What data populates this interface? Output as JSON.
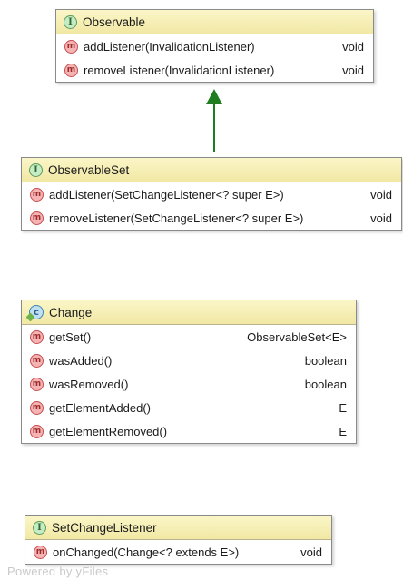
{
  "observable": {
    "title": "Observable",
    "methods": [
      {
        "name": "addListener(InvalidationListener)",
        "ret": "void"
      },
      {
        "name": "removeListener(InvalidationListener)",
        "ret": "void"
      }
    ]
  },
  "observable_set": {
    "title": "ObservableSet",
    "methods": [
      {
        "name": "addListener(SetChangeListener<? super E>)",
        "ret": "void"
      },
      {
        "name": "removeListener(SetChangeListener<? super E>)",
        "ret": "void"
      }
    ]
  },
  "change": {
    "title": "Change",
    "methods": [
      {
        "name": "getSet()",
        "ret": "ObservableSet<E>"
      },
      {
        "name": "wasAdded()",
        "ret": "boolean"
      },
      {
        "name": "wasRemoved()",
        "ret": "boolean"
      },
      {
        "name": "getElementAdded()",
        "ret": "E"
      },
      {
        "name": "getElementRemoved()",
        "ret": "E"
      }
    ]
  },
  "set_change_listener": {
    "title": "SetChangeListener",
    "methods": [
      {
        "name": "onChanged(Change<? extends E>)",
        "ret": "void"
      }
    ]
  },
  "icons": {
    "interface": "I",
    "class": "c",
    "method": "m"
  },
  "colors": {
    "header": "#f4ecb2",
    "inheritance_arrow": "#1f7d1f"
  },
  "footer": "Powered by yFiles"
}
